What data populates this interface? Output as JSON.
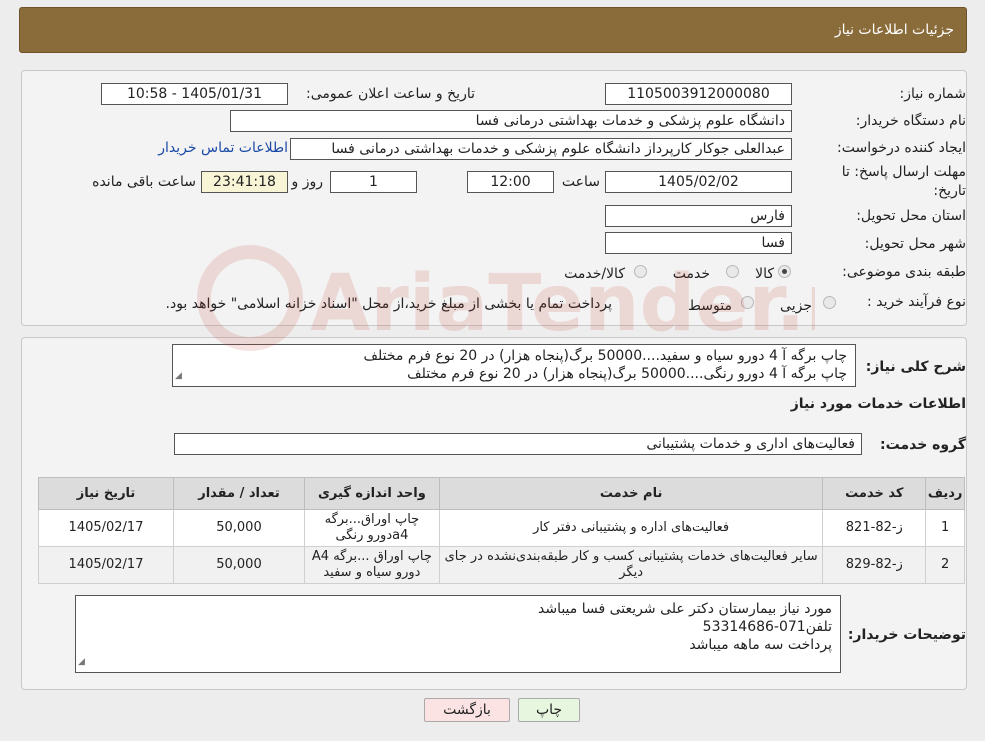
{
  "header": {
    "title": "جزئیات اطلاعات نیاز"
  },
  "form": {
    "need_number_label": "شماره نیاز:",
    "need_number": "1105003912000080",
    "announce_label": "تاریخ و ساعت اعلان عمومی:",
    "announce_value": "1405/01/31 - 10:58",
    "buyer_org_label": "نام دستگاه خریدار:",
    "buyer_org": "دانشگاه علوم پزشکی و خدمات بهداشتی درمانی فسا",
    "requester_label": "ایجاد کننده درخواست:",
    "requester": "عبدالعلی جوکار کارپرداز دانشگاه علوم پزشکی و خدمات بهداشتی درمانی فسا",
    "contact_link": "اطلاعات تماس خریدار",
    "deadline_label_1": "مهلت ارسال پاسخ: تا",
    "deadline_label_2": "تاریخ:",
    "deadline_date": "1405/02/02",
    "time_label": "ساعت",
    "deadline_time": "12:00",
    "days_value": "1",
    "days_label": "روز و",
    "remaining_time": "23:41:18",
    "remaining_label": "ساعت باقی مانده",
    "province_label": "استان محل تحویل:",
    "province": "فارس",
    "city_label": "شهر محل تحویل:",
    "city": "فسا",
    "category_label": "طبقه بندی موضوعی:",
    "category_options": [
      "کالا",
      "خدمت",
      "کالا/خدمت"
    ],
    "category_selected": "کالا",
    "process_label": "نوع فرآیند خرید :",
    "process_options": [
      "جزیی",
      "متوسط"
    ],
    "process_note": "پرداخت تمام یا بخشی از مبلغ خرید،از محل \"اسناد خزانه اسلامی\" خواهد بود."
  },
  "summary": {
    "label": "شرح کلی نیاز:",
    "line1": "چاپ برگه آ 4 دورو سیاه و سفید....50000 برگ(پنجاه هزار) در 20 نوع فرم مختلف",
    "line2": "چاپ برگه آ 4 دورو رنگی....50000 برگ(پنجاه هزار) در 20 نوع فرم مختلف"
  },
  "services": {
    "section_title": "اطلاعات خدمات مورد نیاز",
    "group_label": "گروه خدمت:",
    "group_value": "فعالیت‌های اداری و خدمات پشتیبانی",
    "columns": [
      "ردیف",
      "کد خدمت",
      "نام خدمت",
      "واحد اندازه گیری",
      "تعداد / مقدار",
      "تاریخ نیاز"
    ],
    "rows": [
      {
        "row": "1",
        "code": "ز-82-821",
        "name": "فعالیت‌های اداره و پشتیبانی دفتر کار",
        "unit": "چاپ اوراق...برگه a4دورو رنگی",
        "qty": "50,000",
        "date": "1405/02/17"
      },
      {
        "row": "2",
        "code": "ز-82-829",
        "name": "سایر فعالیت‌های خدمات پشتیبانی کسب و کار طبقه‌بندی‌نشده در جای دیگر",
        "unit": "چاپ اوراق ...برگه A4 دورو سیاه و سفید",
        "qty": "50,000",
        "date": "1405/02/17"
      }
    ]
  },
  "buyer_notes": {
    "label": "توضیحات خریدار:",
    "line1": "مورد نیاز بیمارستان دکتر علی شریعتی فسا میباشد",
    "line2": "تلفن071-53314686",
    "line3": "پرداخت سه ماهه میباشد"
  },
  "buttons": {
    "print": "چاپ",
    "back": "بازگشت"
  },
  "watermark": {
    "text": "AriaTender.neT"
  },
  "colors": {
    "header_bg": "#8a6b3a",
    "link": "#1a49a6",
    "back_button_bg": "#fbe3e3",
    "print_button_bg": "#e6f6df"
  }
}
